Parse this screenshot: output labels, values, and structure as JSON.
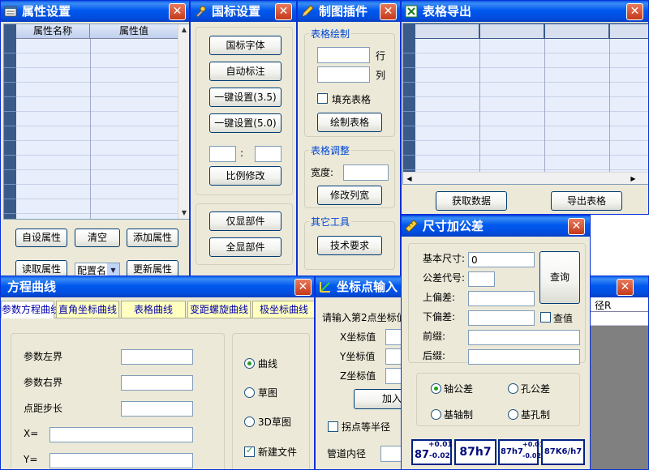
{
  "props": {
    "title": "属性设置",
    "col_name": "属性名称",
    "col_value": "属性值",
    "btn_custom": "自设属性",
    "btn_clear": "清空",
    "btn_add": "添加属性",
    "btn_read": "读取属性",
    "config_label": "配置名",
    "btn_update": "更新属性"
  },
  "gb": {
    "title": "国标设置",
    "btn_font": "国标字体",
    "btn_auto": "自动标注",
    "btn_35": "一键设置(3.5)",
    "btn_50": "一键设置(5.0)",
    "colon": ":",
    "btn_scale": "比例修改",
    "btn_show_part": "仅显部件",
    "btn_show_all": "全显部件"
  },
  "plugin": {
    "title": "制图插件",
    "grp_draw": "表格绘制",
    "row_label": "行",
    "col_label": "列",
    "fill_table": "填充表格",
    "btn_draw": "绘制表格",
    "grp_adjust": "表格调整",
    "width_label": "宽度:",
    "btn_colwidth": "修改列宽",
    "grp_other": "其它工具",
    "btn_tech": "技术要求"
  },
  "export": {
    "title": "表格导出",
    "btn_get": "获取数据",
    "btn_export": "导出表格"
  },
  "tol": {
    "title": "尺寸加公差",
    "basic_label": "基本尺寸:",
    "basic_value": "0",
    "code_label": "公差代号:",
    "upper_label": "上偏差:",
    "lower_label": "下偏差:",
    "btn_query": "查询",
    "check_label": "查值",
    "prefix_label": "前缀:",
    "suffix_label": "后缀:",
    "r_shaft": "轴公差",
    "r_hole": "孔公差",
    "r_shaft_base": "基轴制",
    "r_hole_base": "基孔制",
    "p1_main": "87",
    "p1_up": "+0.01",
    "p1_low": "-0.02",
    "p2": "87h7",
    "p3_main": "87h7",
    "p3_up": "+0.01",
    "p3_low": "-0.02",
    "p4": "87K6/h7"
  },
  "coord": {
    "title": "坐标点输入",
    "prompt": "请输入第2点坐标值",
    "x_label": "X坐标值",
    "y_label": "Y坐标值",
    "z_label": "Z坐标值",
    "btn_add": "加入",
    "chk_label": "拐点等半径",
    "pipe_label": "管道内径"
  },
  "mini": {
    "col": "径R"
  },
  "eq": {
    "title": "方程曲线",
    "tabs": [
      "参数方程曲线",
      "直角坐标曲线",
      "表格曲线",
      "变距螺旋曲线",
      "极坐标曲线"
    ],
    "param_left": "参数左界",
    "param_right": "参数右界",
    "step": "点距步长",
    "x_label": "X=",
    "y_label": "Y=",
    "r_curve": "曲线",
    "r_sketch": "草图",
    "r_3d": "3D草图",
    "chk_new": "新建文件"
  }
}
